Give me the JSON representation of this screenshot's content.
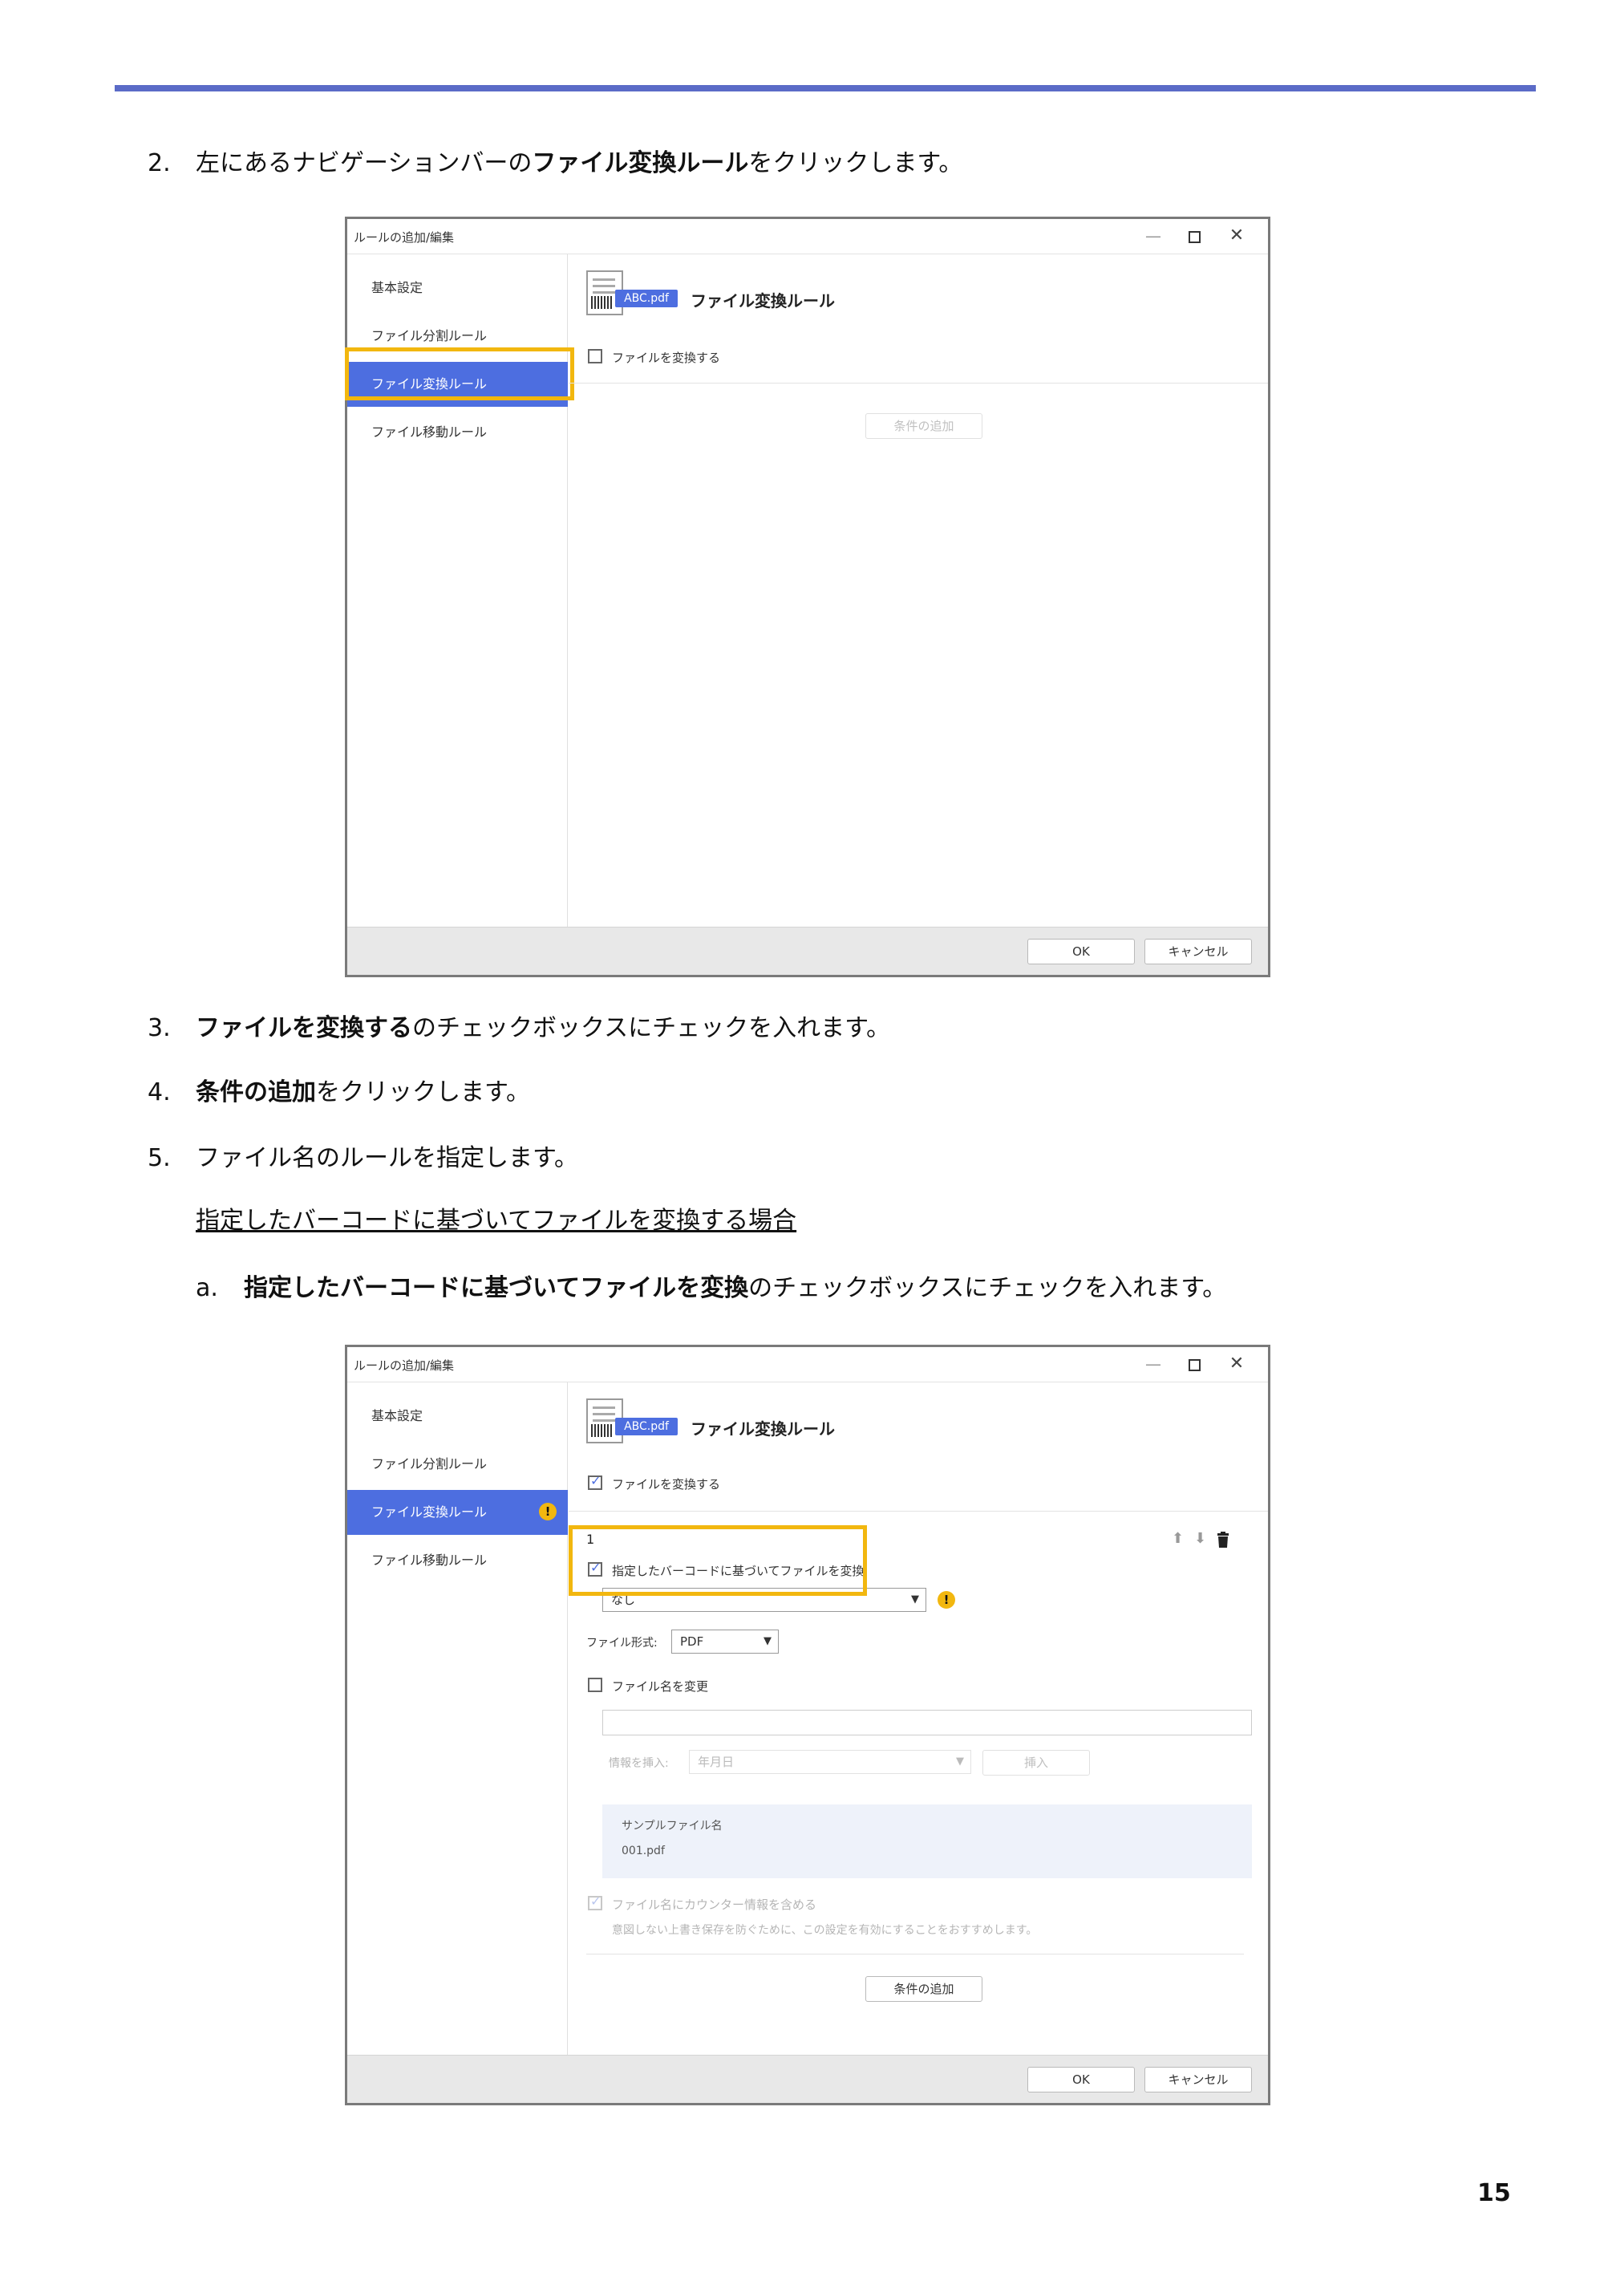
{
  "steps": {
    "s2": {
      "num": "2.",
      "pre": "左にあるナビゲーションバーの",
      "bold": "ファイル変換ルール",
      "post": "をクリックします。"
    },
    "s3": {
      "num": "3.",
      "bold": "ファイルを変換する",
      "post": "のチェックボックスにチェックを入れます。"
    },
    "s4": {
      "num": "4.",
      "bold": "条件の追加",
      "post": "をクリックします。"
    },
    "s5": {
      "num": "5.",
      "text": "ファイル名のルールを指定します。"
    },
    "subheading": "指定したバーコードに基づいてファイルを変換する場合",
    "sa": {
      "num": "a.",
      "bold": "指定したバーコードに基づいてファイルを変換",
      "post": "のチェックボックスにチェックを入れます。"
    }
  },
  "page_number": "15",
  "dialog": {
    "title": "ルールの追加/編集",
    "window_controls": {
      "minimize": "—",
      "close": "✕"
    },
    "sidebar": [
      "基本設定",
      "ファイル分割ルール",
      "ファイル変換ルール",
      "ファイル移動ルール"
    ],
    "warn_glyph": "!",
    "badge": "ABC.pdf",
    "rule_title": "ファイル変換ルール",
    "convert_checkbox": "ファイルを変換する",
    "add_condition": "条件の追加",
    "ok": "OK",
    "cancel": "キャンセル",
    "condition": {
      "index": "1",
      "barcode_checkbox": "指定したバーコードに基づいてファイルを変換",
      "barcode_select": "なし",
      "format_label": "ファイル形式:",
      "format_value": "PDF",
      "rename_checkbox": "ファイル名を変更",
      "insert_label": "情報を挿入:",
      "insert_select": "年月日",
      "insert_button": "挿入",
      "sample_label": "サンプルファイル名",
      "sample_value": "001.pdf",
      "counter_checkbox": "ファイル名にカウンター情報を含める",
      "counter_note": "意図しない上書き保存を防ぐために、この設定を有効にすることをおすすめします。"
    }
  },
  "colors": {
    "accent": "#4d6ee0",
    "highlight": "#f2b70f",
    "rule": "#5b6bc7"
  }
}
